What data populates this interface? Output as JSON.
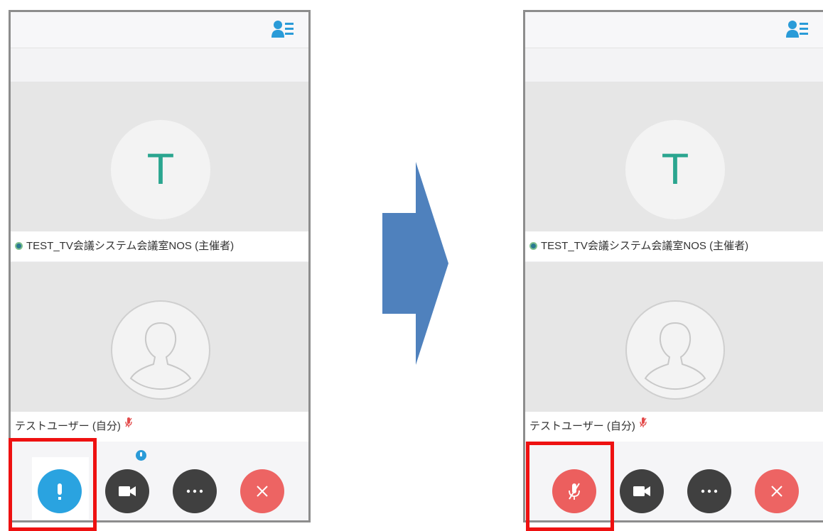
{
  "before": {
    "participants": [
      {
        "avatar_letter": "T",
        "name": "TEST_TV会議システム会議室NOS (主催者)"
      },
      {
        "avatar_letter": "",
        "name": "テストユーザー (自分)"
      }
    ],
    "controls": [
      {
        "icon": "microphone-icon",
        "state": "unmuted",
        "color": "#2aa3e0"
      },
      {
        "icon": "video-camera-icon",
        "color": "#404040"
      },
      {
        "icon": "more-options-icon",
        "color": "#404040"
      },
      {
        "icon": "close-icon",
        "color": "#ed6463"
      }
    ]
  },
  "after": {
    "participants": [
      {
        "avatar_letter": "T",
        "name": "TEST_TV会議システム会議室NOS (主催者)"
      },
      {
        "avatar_letter": "",
        "name": "テストユーザー (自分)"
      }
    ],
    "controls": [
      {
        "icon": "microphone-muted-icon",
        "state": "muted",
        "color": "#ec5f5e"
      },
      {
        "icon": "video-camera-icon",
        "color": "#404040"
      },
      {
        "icon": "more-options-icon",
        "color": "#404040"
      },
      {
        "icon": "close-icon",
        "color": "#ed6463"
      }
    ]
  },
  "colors": {
    "accent_teal": "#2aa58f",
    "highlight_red": "#ee1111",
    "arrow_blue": "#4f81bd",
    "contacts_icon_blue": "#2a9bd8"
  }
}
